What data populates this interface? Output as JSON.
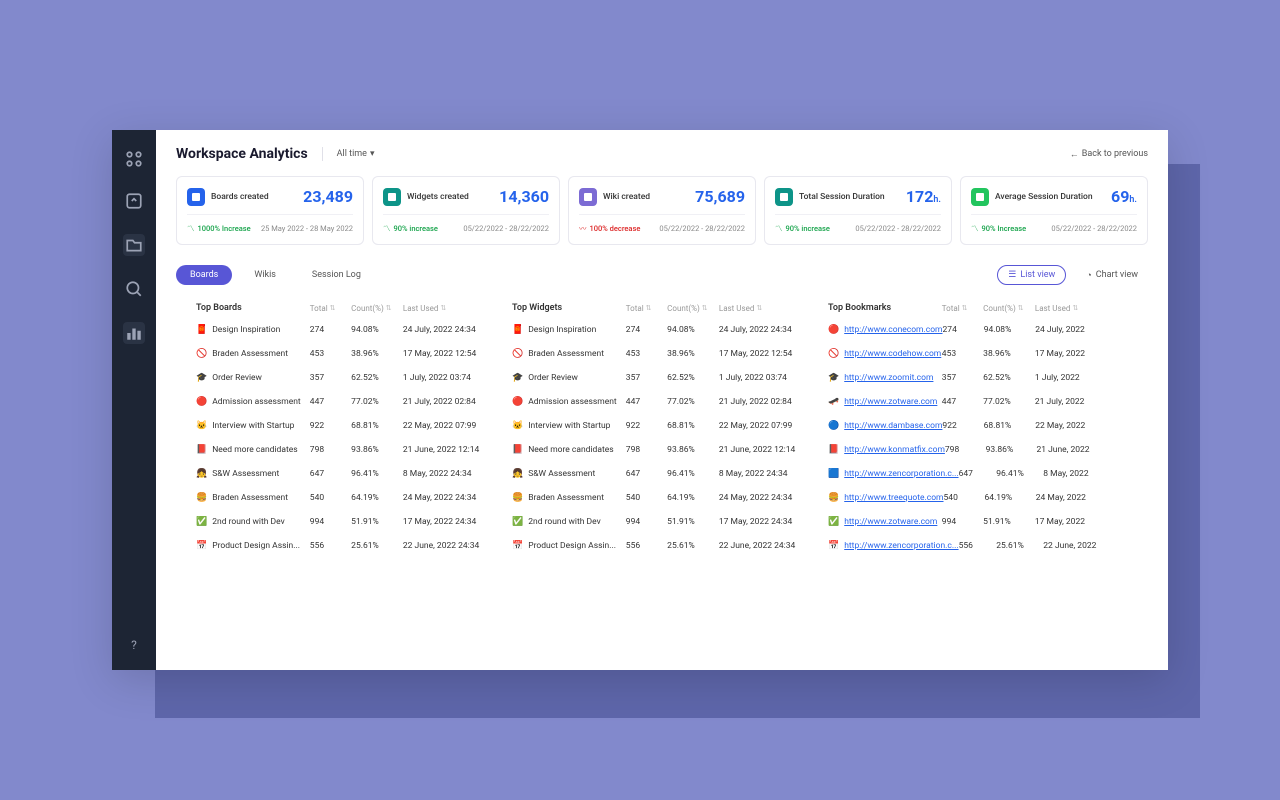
{
  "header": {
    "title": "Workspace Analytics",
    "time": "All time",
    "back": "Back to previous"
  },
  "cards": [
    {
      "label": "Boards created",
      "value": "23,489",
      "unit": "",
      "trend": "up",
      "trendText": "1000% Increase",
      "dates": "25 May 2022 - 28 May 2022"
    },
    {
      "label": "Widgets created",
      "value": "14,360",
      "unit": "",
      "trend": "up",
      "trendText": "90% increase",
      "dates": "05/22/2022 - 28/22/2022"
    },
    {
      "label": "Wiki created",
      "value": "75,689",
      "unit": "",
      "trend": "down",
      "trendText": "100% decrease",
      "dates": "05/22/2022 - 28/22/2022"
    },
    {
      "label": "Total Session Duration",
      "value": "172",
      "unit": "h.",
      "trend": "up",
      "trendText": "90% increase",
      "dates": "05/22/2022 - 28/22/2022"
    },
    {
      "label": "Average Session Duration",
      "value": "69",
      "unit": "h.",
      "trend": "up",
      "trendText": "90% Increase",
      "dates": "05/22/2022 - 28/22/2022"
    }
  ],
  "tabs": [
    "Boards",
    "Wikis",
    "Session Log"
  ],
  "views": {
    "list": "List view",
    "chart": "Chart view"
  },
  "headers": {
    "total": "Total",
    "count": "Count(%)",
    "last": "Last Used"
  },
  "tables": [
    {
      "title": "Top Boards",
      "rows": [
        {
          "icon": "🧧",
          "name": "Design Inspiration",
          "total": "274",
          "count": "94.08%",
          "last": "24 July, 2022  24:34"
        },
        {
          "icon": "🚫",
          "name": "Braden Assessment",
          "total": "453",
          "count": "38.96%",
          "last": "17 May, 2022  12:54"
        },
        {
          "icon": "🎓",
          "name": "Order Review",
          "total": "357",
          "count": "62.52%",
          "last": "1 July, 2022 03:74"
        },
        {
          "icon": "🔴",
          "name": "Admission assessment",
          "total": "447",
          "count": "77.02%",
          "last": "21 July, 2022  02:84"
        },
        {
          "icon": "🐱",
          "name": "Interview with Startup",
          "total": "922",
          "count": "68.81%",
          "last": "22 May, 2022  07:99"
        },
        {
          "icon": "📕",
          "name": "Need more candidates",
          "total": "798",
          "count": "93.86%",
          "last": "21 June, 2022  12:14"
        },
        {
          "icon": "👧",
          "name": "S&W Assessment",
          "total": "647",
          "count": "96.41%",
          "last": "8 May, 2022  24:34"
        },
        {
          "icon": "🍔",
          "name": "Braden Assessment",
          "total": "540",
          "count": "64.19%",
          "last": "24 May, 2022 24:34"
        },
        {
          "icon": "✅",
          "name": "2nd round with Dev",
          "total": "994",
          "count": "51.91%",
          "last": "17 May, 2022  24:34"
        },
        {
          "icon": "📅",
          "name": "Product Design Assin...",
          "total": "556",
          "count": "25.61%",
          "last": "22 June, 2022  24:34"
        }
      ]
    },
    {
      "title": "Top Widgets",
      "rows": [
        {
          "icon": "🧧",
          "name": "Design Inspiration",
          "total": "274",
          "count": "94.08%",
          "last": "24 July, 2022  24:34"
        },
        {
          "icon": "🚫",
          "name": "Braden Assessment",
          "total": "453",
          "count": "38.96%",
          "last": "17 May, 2022  12:54"
        },
        {
          "icon": "🎓",
          "name": "Order Review",
          "total": "357",
          "count": "62.52%",
          "last": "1 July, 2022 03:74"
        },
        {
          "icon": "🔴",
          "name": "Admission assessment",
          "total": "447",
          "count": "77.02%",
          "last": "21 July, 2022  02:84"
        },
        {
          "icon": "🐱",
          "name": "Interview with Startup",
          "total": "922",
          "count": "68.81%",
          "last": "22 May, 2022  07:99"
        },
        {
          "icon": "📕",
          "name": "Need more candidates",
          "total": "798",
          "count": "93.86%",
          "last": "21 June, 2022  12:14"
        },
        {
          "icon": "👧",
          "name": "S&W Assessment",
          "total": "647",
          "count": "96.41%",
          "last": "8 May, 2022  24:34"
        },
        {
          "icon": "🍔",
          "name": "Braden Assessment",
          "total": "540",
          "count": "64.19%",
          "last": "24 May, 2022 24:34"
        },
        {
          "icon": "✅",
          "name": "2nd round with Dev",
          "total": "994",
          "count": "51.91%",
          "last": "17 May, 2022  24:34"
        },
        {
          "icon": "📅",
          "name": "Product Design Assin...",
          "total": "556",
          "count": "25.61%",
          "last": "22 June, 2022  24:34"
        }
      ]
    },
    {
      "title": "Top Bookmarks",
      "rows": [
        {
          "icon": "🔴",
          "name": "http://www.conecom.com",
          "link": true,
          "total": "274",
          "count": "94.08%",
          "last": "24 July, 2022"
        },
        {
          "icon": "🚫",
          "name": "http://www.codehow.com",
          "link": true,
          "total": "453",
          "count": "38.96%",
          "last": "17 May, 2022"
        },
        {
          "icon": "🎓",
          "name": "http://www.zoomit.com",
          "link": true,
          "total": "357",
          "count": "62.52%",
          "last": "1 July, 2022"
        },
        {
          "icon": "🛹",
          "name": "http://www.zotware.com",
          "link": true,
          "total": "447",
          "count": "77.02%",
          "last": "21 July, 2022"
        },
        {
          "icon": "🔵",
          "name": "http://www.dambase.com",
          "link": true,
          "total": "922",
          "count": "68.81%",
          "last": "22 May, 2022"
        },
        {
          "icon": "📕",
          "name": "http://www.konmatfix.com",
          "link": true,
          "total": "798",
          "count": "93.86%",
          "last": "21 June, 2022"
        },
        {
          "icon": "🟦",
          "name": "http://www.zencorporation.c...",
          "link": true,
          "total": "647",
          "count": "96.41%",
          "last": "8 May, 2022"
        },
        {
          "icon": "🍔",
          "name": "http://www.treequote.com",
          "link": true,
          "total": "540",
          "count": "64.19%",
          "last": "24 May, 2022"
        },
        {
          "icon": "✅",
          "name": "http://www.zotware.com",
          "link": true,
          "total": "994",
          "count": "51.91%",
          "last": "17 May, 2022"
        },
        {
          "icon": "📅",
          "name": "http://www.zencorporation.c...",
          "link": true,
          "total": "556",
          "count": "25.61%",
          "last": "22 June, 2022"
        }
      ]
    }
  ]
}
